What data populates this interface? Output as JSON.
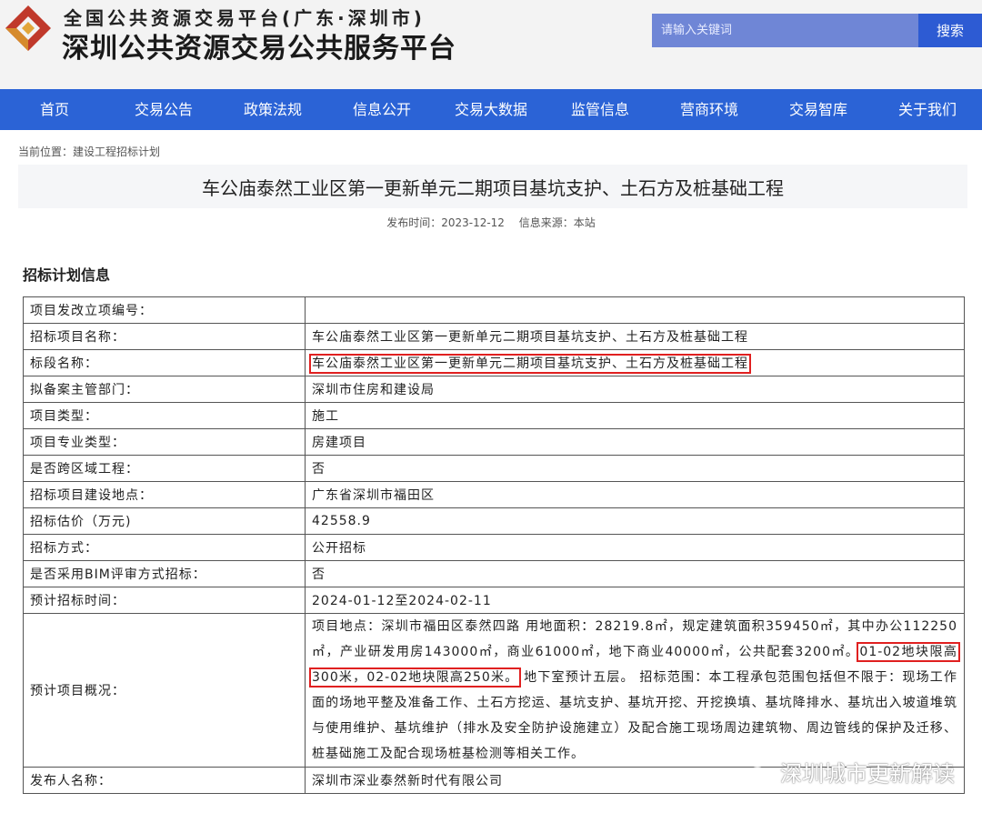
{
  "header": {
    "logo_sub": "全国公共资源交易平台(广东·深圳市)",
    "logo_main": "深圳公共资源交易公共服务平台",
    "search_placeholder": "请输入关键词",
    "search_label": "搜索"
  },
  "nav": [
    {
      "label": "首页"
    },
    {
      "label": "交易公告"
    },
    {
      "label": "政策法规"
    },
    {
      "label": "信息公开"
    },
    {
      "label": "交易大数据"
    },
    {
      "label": "监管信息"
    },
    {
      "label": "营商环境"
    },
    {
      "label": "交易智库"
    },
    {
      "label": "关于我们"
    }
  ],
  "breadcrumb": {
    "prefix": "当前位置：",
    "current": "建设工程招标计划"
  },
  "article": {
    "title": "车公庙泰然工业区第一更新单元二期项目基坑支护、土石方及桩基础工程",
    "publish": "发布时间：2023-12-12",
    "source": "信息来源：本站"
  },
  "section_title": "招标计划信息",
  "rows": [
    {
      "label": "项目发改立项编号：",
      "value": ""
    },
    {
      "label": "招标项目名称：",
      "value": "车公庙泰然工业区第一更新单元二期项目基坑支护、土石方及桩基础工程"
    },
    {
      "label": "标段名称：",
      "value": "车公庙泰然工业区第一更新单元二期项目基坑支护、土石方及桩基础工程"
    },
    {
      "label": "拟备案主管部门：",
      "value": "深圳市住房和建设局"
    },
    {
      "label": "项目类型：",
      "value": "施工"
    },
    {
      "label": "项目专业类型：",
      "value": "房建项目"
    },
    {
      "label": "是否跨区域工程：",
      "value": "否"
    },
    {
      "label": "招标项目建设地点：",
      "value": "广东省深圳市福田区"
    },
    {
      "label": "招标估价（万元)",
      "value": "42558.9"
    },
    {
      "label": "招标方式：",
      "value": "公开招标"
    },
    {
      "label": "是否采用BIM评审方式招标：",
      "value": "否"
    },
    {
      "label": "预计招标时间：",
      "value": "2024-01-12至2024-02-11"
    }
  ],
  "overview": {
    "label": "预计项目概况：",
    "part1": "项目地点：深圳市福田区泰然四路 用地面积：28219.8㎡，规定建筑面积359450㎡，其中办公112250㎡，产业研发用房143000㎡，商业61000㎡，地下商业40000㎡，公共配套3200㎡。",
    "highlight": "01-02地块限高300米，02-02地块限高250米。",
    "part2": "地下室预计五层。 招标范围：本工程承包范围包括但不限于：现场工作面的场地平整及准备工作、土石方挖运、基坑支护、基坑开挖、开挖换填、基坑降排水、基坑出入坡道堆筑与使用维护、基坑维护（排水及安全防护设施建立）及配合施工现场周边建筑物、周边管线的保护及迁移、桩基础施工及配合现场桩基检测等相关工作。"
  },
  "publisher": {
    "label": "发布人名称：",
    "value": "深圳市深业泰然新时代有限公司"
  },
  "watermark": "深圳城市更新解读"
}
